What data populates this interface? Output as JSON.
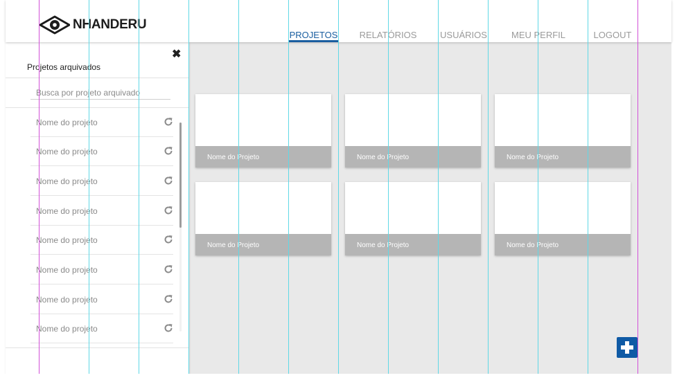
{
  "app": {
    "name": "NHANDERU",
    "logo_icon": "eye-icon"
  },
  "nav": {
    "items": [
      {
        "label": "PROJETOS",
        "active": true
      },
      {
        "label": "RELATÓRIOS",
        "active": false
      },
      {
        "label": "USUÁRIOS",
        "active": false
      },
      {
        "label": "MEU PERFIL",
        "active": false
      },
      {
        "label": "LOGOUT",
        "active": false
      }
    ]
  },
  "sidebar": {
    "title": "Projetos arquivados",
    "close_icon": "close-icon",
    "search_placeholder": "Busca por projeto arquivado",
    "items": [
      {
        "label": "Nome do projeto",
        "icon": "restore-icon"
      },
      {
        "label": "Nome do projeto",
        "icon": "restore-icon"
      },
      {
        "label": "Nome do projeto",
        "icon": "restore-icon"
      },
      {
        "label": "Nome do projeto",
        "icon": "restore-icon"
      },
      {
        "label": "Nome do projeto",
        "icon": "restore-icon"
      },
      {
        "label": "Nome do projeto",
        "icon": "restore-icon"
      },
      {
        "label": "Nome do projeto",
        "icon": "restore-icon"
      },
      {
        "label": "Nome do projeto",
        "icon": "restore-icon"
      }
    ]
  },
  "projects": [
    {
      "name": "Nome do Projeto"
    },
    {
      "name": "Nome do Projeto"
    },
    {
      "name": "Nome do Projeto"
    },
    {
      "name": "Nome do Projeto"
    },
    {
      "name": "Nome do Projeto"
    },
    {
      "name": "Nome do Projeto"
    }
  ],
  "fab": {
    "icon": "plus-icon"
  },
  "colors": {
    "accent": "#1a5ea0",
    "fab": "#0f5aa5",
    "card_footer": "#b5b5b5",
    "background": "#e9e9e9",
    "guide_cyan": "#5fd8e6",
    "guide_magenta": "#d24fd8"
  }
}
